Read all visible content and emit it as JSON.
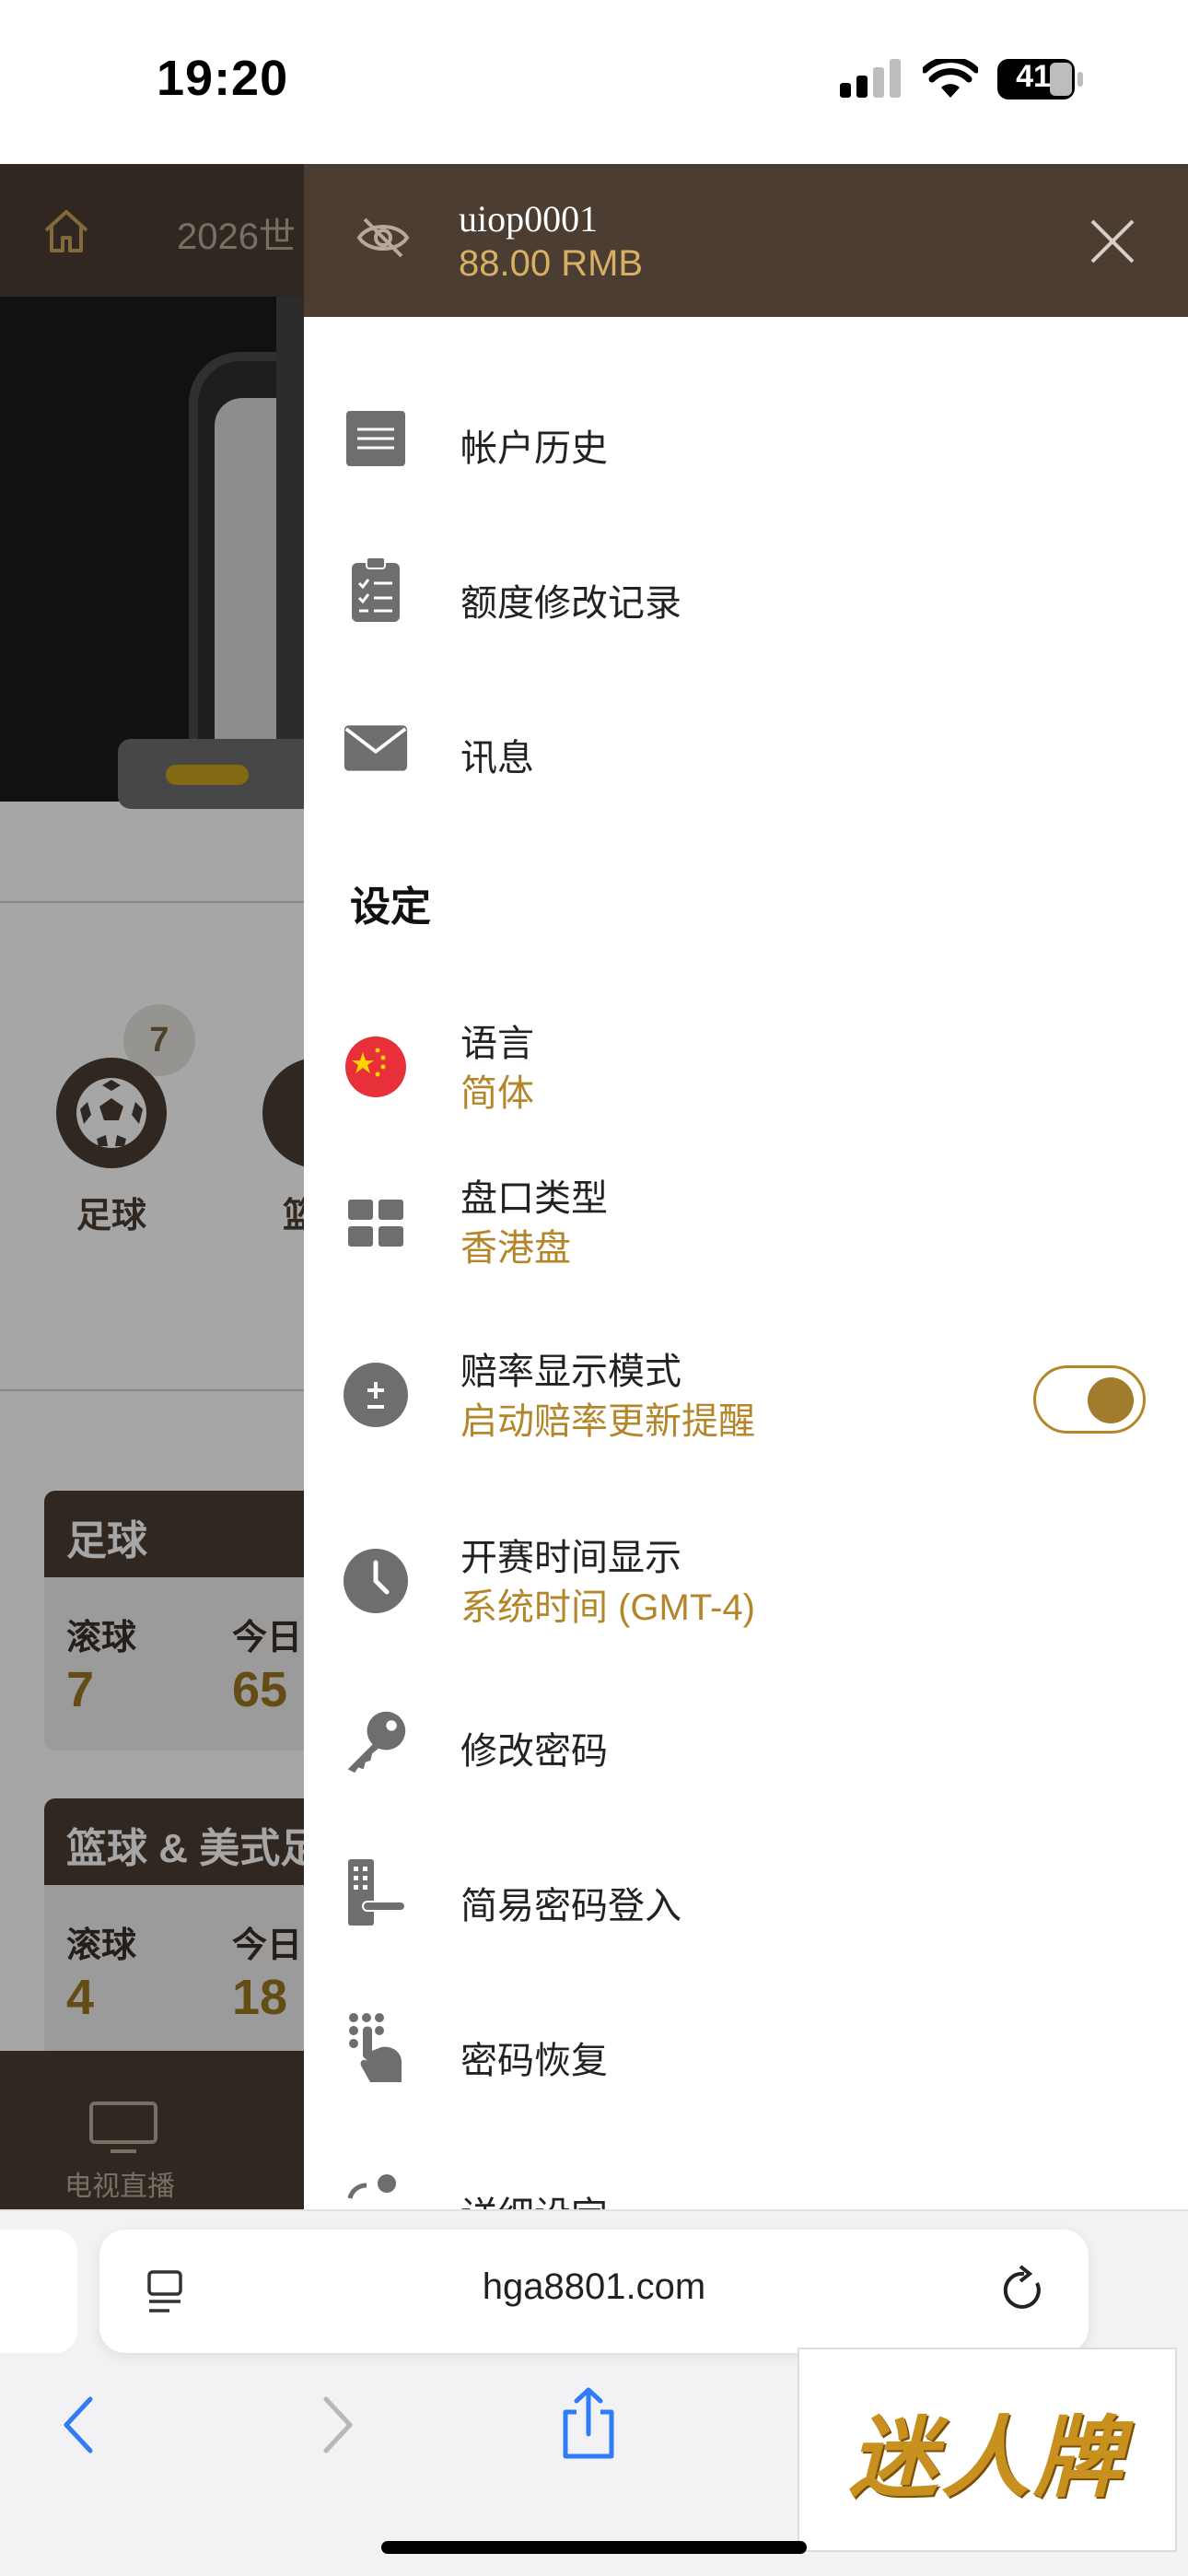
{
  "status_bar": {
    "time": "19:20",
    "battery": "41"
  },
  "background": {
    "header_title": "2026世",
    "sports": [
      {
        "label": "足球",
        "badge": "7"
      },
      {
        "label": "篮球"
      }
    ],
    "cards": [
      {
        "title": "足球",
        "col1_label": "滚球",
        "col1_value": "7",
        "col2_label": "今日",
        "col2_value": "65"
      },
      {
        "title": "篮球 & 美式足",
        "col1_label": "滚球",
        "col1_value": "4",
        "col2_label": "今日",
        "col2_value": "18"
      }
    ],
    "bottom_nav": {
      "tv_label": "电视直播"
    }
  },
  "drawer": {
    "username": "uiop0001",
    "balance": "88.00  RMB",
    "items": [
      {
        "label": "帐户历史",
        "icon": "document-list-icon"
      },
      {
        "label": "额度修改记录",
        "icon": "clipboard-checklist-icon"
      },
      {
        "label": "讯息",
        "icon": "envelope-icon"
      }
    ],
    "settings_title": "设定",
    "settings": [
      {
        "label": "语言",
        "value": "简体",
        "icon": "china-flag-icon"
      },
      {
        "label": "盘口类型",
        "value": "香港盘",
        "icon": "grid-icon"
      },
      {
        "label": "赔率显示模式",
        "value": "启动赔率更新提醒",
        "icon": "plus-minus-icon",
        "toggle_on": true
      },
      {
        "label": "开赛时间显示",
        "value": "系统时间 (GMT-4)",
        "icon": "clock-icon"
      },
      {
        "label": "修改密码",
        "icon": "key-icon"
      },
      {
        "label": "简易密码登入",
        "icon": "door-lock-icon"
      },
      {
        "label": "密码恢复",
        "icon": "keypad-hand-icon"
      },
      {
        "label": "详细设定",
        "icon": "user-settings-icon"
      }
    ]
  },
  "browser": {
    "url": "hga8801.com",
    "watermark": "迷人牌"
  },
  "colors": {
    "brand_brown": "#4b3d32",
    "accent_gold": "#b4862a",
    "balance_gold": "#d7b063"
  }
}
